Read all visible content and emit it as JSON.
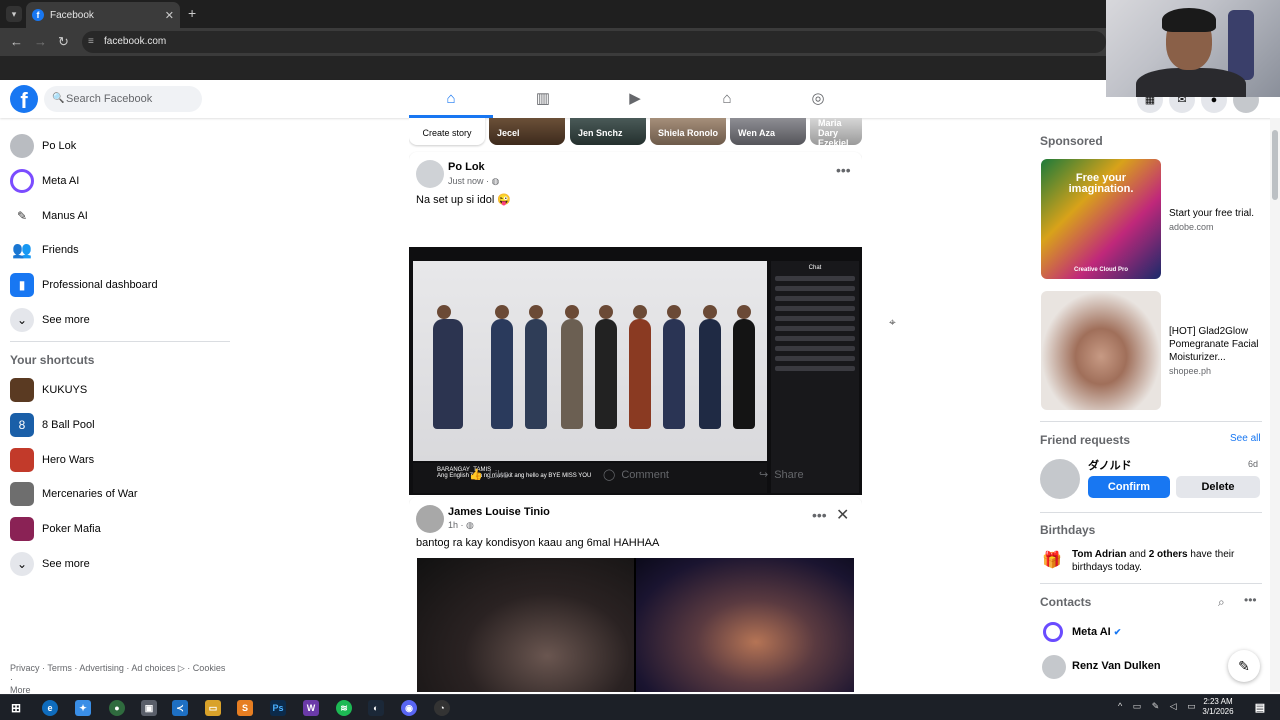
{
  "browser": {
    "tab_title": "Facebook",
    "tab_favicon": "f",
    "tab_close": "✕",
    "new_tab": "+",
    "url": "facebook.com"
  },
  "header": {
    "logo": "f",
    "search_placeholder": "Search Facebook",
    "nav_icons": [
      "home-icon",
      "stats-icon",
      "video-icon",
      "marketplace-icon",
      "gaming-icon"
    ]
  },
  "sidebar": {
    "items": [
      {
        "label": "Po Lok",
        "icon": "avatar-icon"
      },
      {
        "label": "Meta AI",
        "icon": "meta-ai-icon"
      },
      {
        "label": "Manus AI",
        "icon": "manus-icon"
      },
      {
        "label": "Friends",
        "icon": "friends-icon"
      },
      {
        "label": "Professional dashboard",
        "icon": "dashboard-icon"
      },
      {
        "label": "See more",
        "icon": "chevron-down-icon"
      }
    ],
    "shortcuts_title": "Your shortcuts",
    "shortcuts": [
      {
        "label": "KUKUYS"
      },
      {
        "label": "8 Ball Pool"
      },
      {
        "label": "Hero Wars"
      },
      {
        "label": "Mercenaries of War"
      },
      {
        "label": "Poker Mafia"
      },
      {
        "label": "See more"
      }
    ],
    "footer_line1": "Privacy · Terms · Advertising · Ad choices ▷ · Cookies ·",
    "footer_line2": "More"
  },
  "stories": {
    "create": "Create story",
    "names": [
      "Jecel",
      "Jen Snchz",
      "Shiela Ronolo",
      "Wen Aza",
      "Maria Dary Ezekiel"
    ]
  },
  "posts": [
    {
      "author": "Po Lok",
      "time": "Just now ·",
      "text": "Na set up si idol 😜",
      "stream_channel": "BARANGAY_TAMIS",
      "stream_caption": "Ang English pala ng masakit ang hello ay BYE MISS YOU",
      "stream_chat_title": "Chat",
      "actions": {
        "like": "Like",
        "comment": "Comment",
        "share": "Share"
      }
    },
    {
      "author": "James Louise Tinio",
      "time": "1h ·",
      "text": "bantog ra kay kondisyon kaau ang 6mal HAHHAA"
    }
  ],
  "right": {
    "sponsored_title": "Sponsored",
    "ads": [
      {
        "title": "Start your free trial.",
        "source": "adobe.com",
        "image_text": "Free your imagination.",
        "image_brand": "Creative Cloud Pro"
      },
      {
        "title": "[HOT] Glad2Glow Pomegranate Facial Moisturizer...",
        "source": "shopee.ph"
      }
    ],
    "friend_requests": {
      "title": "Friend requests",
      "see_all": "See all",
      "name": "ダノルド",
      "age": "6d",
      "confirm": "Confirm",
      "delete": "Delete"
    },
    "birthdays": {
      "title": "Birthdays",
      "name": "Tom Adrian",
      "and": " and ",
      "others": "2 others",
      "rest": " have their birthdays today."
    },
    "contacts": {
      "title": "Contacts",
      "items": [
        "Meta AI",
        "Renz Van Dulken"
      ]
    }
  },
  "taskbar": {
    "time": "2:23 AM",
    "date": "3/1/2026"
  },
  "colors": {
    "fb_blue": "#1877f2",
    "text_secondary": "#65676b"
  }
}
